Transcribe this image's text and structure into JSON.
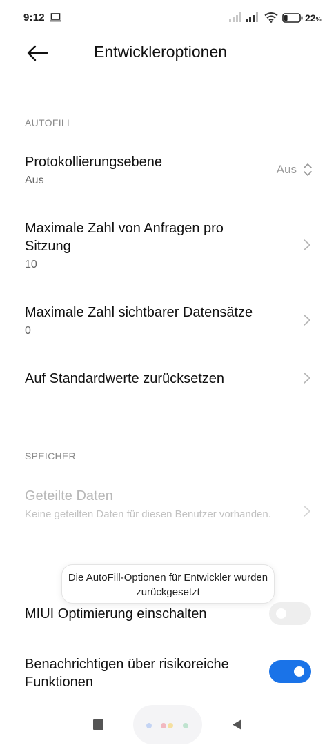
{
  "status_bar": {
    "time": "9:12",
    "battery_percent": "22",
    "battery_unit": "%",
    "battery_level": 0.22,
    "icons": [
      "laptop-icon",
      "signal-icon",
      "signal-icon",
      "wifi-icon",
      "battery-icon"
    ]
  },
  "header": {
    "title": "Entwickleroptionen",
    "back_icon": "arrow-left-icon"
  },
  "sections": {
    "autofill": {
      "header": "AUTOFILL",
      "items": [
        {
          "title": "Protokollierungsebene",
          "subtitle": "Aus",
          "value": "Aus"
        },
        {
          "title": "Maximale Zahl von Anfragen pro Sitzung",
          "subtitle": "10"
        },
        {
          "title": "Maximale Zahl sichtbarer Datensätze",
          "subtitle": "0"
        },
        {
          "title": "Auf Standardwerte zurücksetzen"
        }
      ]
    },
    "speicher": {
      "header": "SPEICHER",
      "items": [
        {
          "title": "Geteilte Daten",
          "subtitle": "Keine geteilten Daten für diesen Benutzer vorhanden.",
          "enabled": false
        }
      ]
    },
    "toggles": {
      "items": [
        {
          "title": "MIUI Optimierung einschalten",
          "on": false
        },
        {
          "title": "Benachrichtigen über risikoreiche Funktionen",
          "on": true
        }
      ]
    }
  },
  "toast": {
    "text": "Die AutoFill-Optionen für Entwickler wurden zurückgesetzt"
  },
  "nav_bar": {
    "icons": [
      "recents-square-icon",
      "assistant-pill-icon",
      "back-triangle-icon"
    ],
    "dot_colors": [
      "#c4d4f4",
      "#f2b8c0",
      "#f5e0a0",
      "#bfe3cf"
    ]
  },
  "colors": {
    "accent": "#1a73e8",
    "section_header": "#8a8a8a",
    "disabled_text": "#b8b8b8"
  }
}
